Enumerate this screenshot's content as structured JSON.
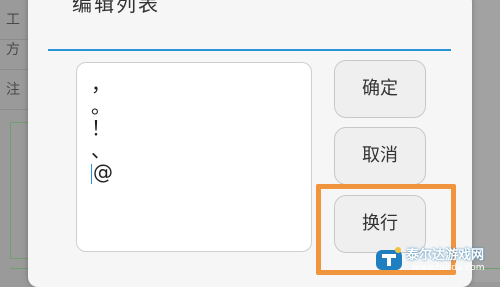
{
  "background": {
    "rows": [
      "工",
      "方",
      "注"
    ]
  },
  "dialog": {
    "title": "编辑列表",
    "text_lines": [
      "，",
      "。",
      "！",
      "、",
      "@"
    ],
    "buttons": {
      "confirm": "确定",
      "cancel": "取消",
      "newline": "换行"
    }
  },
  "watermark": {
    "name": "泰尔达游戏网",
    "url": "www.tairda.com"
  },
  "colors": {
    "accent": "#2a93d5",
    "highlight": "#f0943d"
  }
}
